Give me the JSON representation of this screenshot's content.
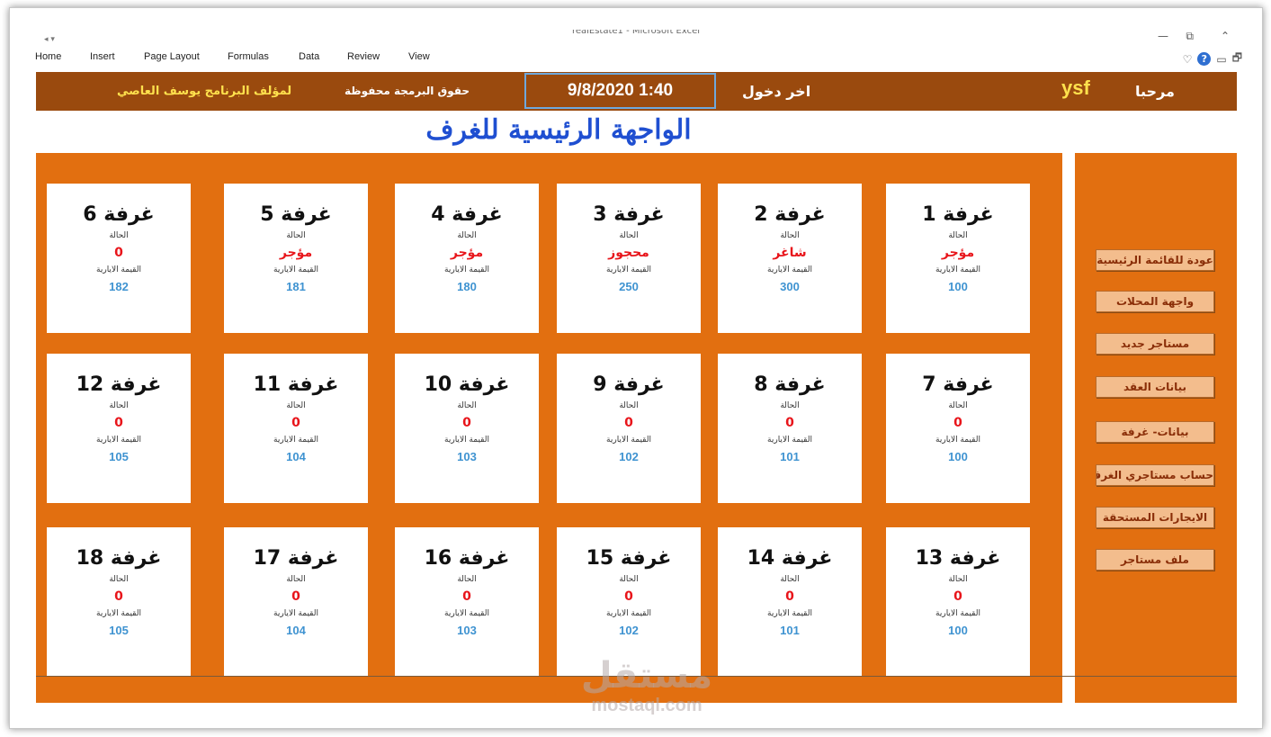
{
  "window": {
    "title": "realEstate1 - Microsoft Excel",
    "menu": [
      "Home",
      "Insert",
      "Page Layout",
      "Formulas",
      "Data",
      "Review",
      "View"
    ]
  },
  "header": {
    "author": "لمؤلف البرنامج يوسف العاصي",
    "rights": "حقوق البرمجة محفوظة",
    "datetime": "9/8/2020 1:40",
    "last_login_label": "اخر دخول",
    "user": "ysf",
    "welcome": "مرحبا"
  },
  "page_title": "الواجهة الرئيسية للغرف",
  "card_labels": {
    "status": "الحالة",
    "rent": "القيمة الايارية"
  },
  "rooms": [
    {
      "name": "غرفة 1",
      "status": "مؤجر",
      "rent": "100"
    },
    {
      "name": "غرفة 2",
      "status": "شاغر",
      "rent": "300"
    },
    {
      "name": "غرفة 3",
      "status": "محجوز",
      "rent": "250"
    },
    {
      "name": "غرفة 4",
      "status": "مؤجر",
      "rent": "180"
    },
    {
      "name": "غرفة 5",
      "status": "مؤجر",
      "rent": "181"
    },
    {
      "name": "غرفة 6",
      "status": "0",
      "rent": "182"
    },
    {
      "name": "غرفة 7",
      "status": "0",
      "rent": "100"
    },
    {
      "name": "غرفة 8",
      "status": "0",
      "rent": "101"
    },
    {
      "name": "غرفة 9",
      "status": "0",
      "rent": "102"
    },
    {
      "name": "غرفة 10",
      "status": "0",
      "rent": "103"
    },
    {
      "name": "غرفة 11",
      "status": "0",
      "rent": "104"
    },
    {
      "name": "غرفة 12",
      "status": "0",
      "rent": "105"
    },
    {
      "name": "غرفة 13",
      "status": "0",
      "rent": "100"
    },
    {
      "name": "غرفة 14",
      "status": "0",
      "rent": "101"
    },
    {
      "name": "غرفة 15",
      "status": "0",
      "rent": "102"
    },
    {
      "name": "غرفة 16",
      "status": "0",
      "rent": "103"
    },
    {
      "name": "غرفة 17",
      "status": "0",
      "rent": "104"
    },
    {
      "name": "غرفة 18",
      "status": "0",
      "rent": "105"
    }
  ],
  "side_buttons": [
    "عودة للقائمة الرئيسية",
    "واجهة المحلات",
    "مستاجر جديد",
    "بيانات العقد",
    "بيانات- غرفة",
    "حساب مستاجري الغرف",
    "الايجارات المستحقة",
    "ملف مستاجر"
  ],
  "watermark": {
    "ar": "مستقل",
    "en": "mostaql.com"
  }
}
